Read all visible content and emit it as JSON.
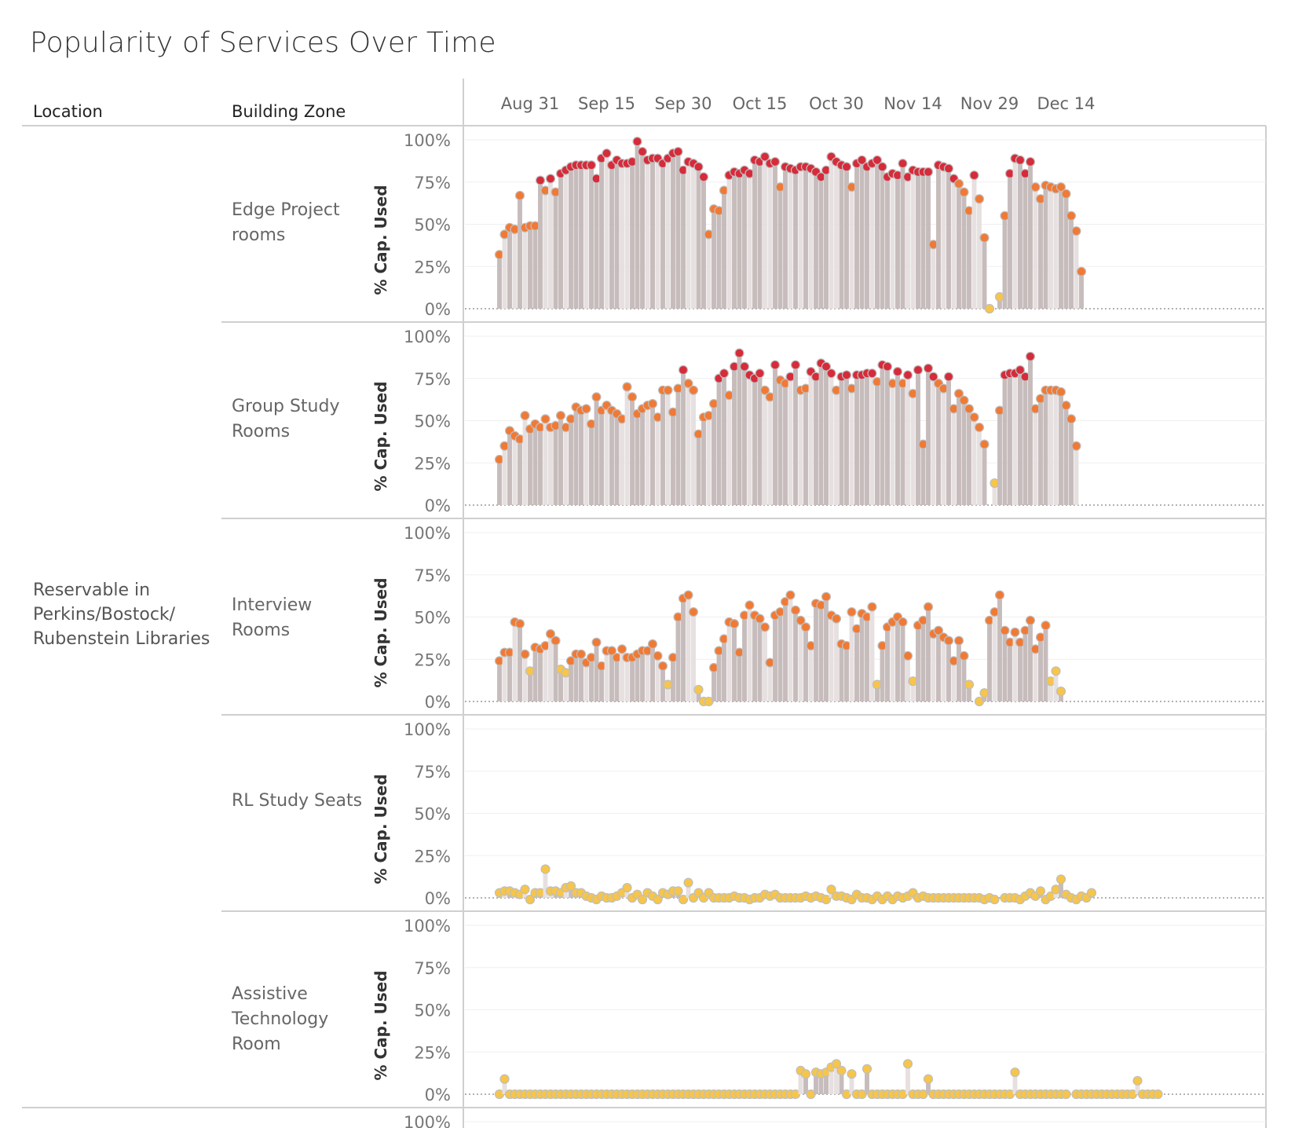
{
  "title": "Popularity of Services Over Time",
  "headers": {
    "location": "Location",
    "zone": "Building Zone"
  },
  "location": "Reservable in Perkins/Bostock/ Rubenstein Libraries",
  "colors": {
    "bar": "#c7bcbc",
    "bar_light": "#e7e0e0",
    "dot_high": "#d62b3a",
    "dot_mid": "#f07a35",
    "dot_low": "#f6c54a"
  },
  "chart_data": {
    "type": "bar",
    "x_ticks": [
      "Aug 31",
      "Sep 15",
      "Sep 30",
      "Oct 15",
      "Oct 30",
      "Nov 14",
      "Nov 29",
      "Dec 14"
    ],
    "x_start": "Aug 25",
    "ylabel": "% Cap. Used",
    "y_ticks": [
      "0%",
      "25%",
      "50%",
      "75%",
      "100%"
    ],
    "ylim": [
      0,
      100
    ],
    "series": [
      {
        "name": "Edge Project rooms",
        "values": [
          32,
          44,
          48,
          47,
          67,
          48,
          49,
          49,
          76,
          70,
          77,
          69,
          80,
          82,
          84,
          85,
          85,
          85,
          85,
          77,
          89,
          92,
          85,
          88,
          86,
          86,
          87,
          99,
          93,
          88,
          89,
          89,
          86,
          89,
          92,
          93,
          82,
          87,
          86,
          84,
          78,
          44,
          59,
          58,
          70,
          79,
          81,
          80,
          82,
          80,
          88,
          87,
          90,
          86,
          87,
          72,
          84,
          83,
          82,
          84,
          84,
          83,
          81,
          78,
          82,
          90,
          87,
          85,
          84,
          72,
          86,
          88,
          84,
          86,
          88,
          84,
          78,
          80,
          79,
          86,
          78,
          82,
          81,
          81,
          81,
          38,
          85,
          84,
          83,
          77,
          74,
          69,
          58,
          79,
          65,
          42,
          0,
          null,
          7,
          55,
          80,
          89,
          88,
          80,
          87,
          72,
          65,
          73,
          72,
          71,
          72,
          68,
          55,
          46,
          22
        ]
      },
      {
        "name": "Group Study Rooms",
        "values": [
          27,
          35,
          44,
          41,
          39,
          53,
          45,
          48,
          46,
          51,
          46,
          47,
          53,
          46,
          51,
          58,
          56,
          57,
          48,
          64,
          56,
          59,
          56,
          54,
          51,
          70,
          64,
          54,
          57,
          59,
          60,
          52,
          68,
          68,
          55,
          69,
          80,
          72,
          68,
          42,
          52,
          53,
          60,
          75,
          78,
          65,
          82,
          90,
          82,
          77,
          75,
          78,
          68,
          64,
          83,
          74,
          72,
          76,
          83,
          68,
          69,
          79,
          76,
          84,
          82,
          78,
          68,
          76,
          77,
          69,
          77,
          77,
          78,
          78,
          73,
          83,
          82,
          72,
          79,
          72,
          77,
          66,
          80,
          36,
          81,
          76,
          72,
          69,
          76,
          57,
          66,
          62,
          57,
          52,
          46,
          36,
          null,
          13,
          56,
          77,
          78,
          78,
          80,
          76,
          88,
          57,
          63,
          68,
          68,
          68,
          67,
          59,
          51,
          35
        ]
      },
      {
        "name": "Interview Rooms",
        "values": [
          24,
          29,
          29,
          47,
          46,
          28,
          18,
          32,
          31,
          33,
          40,
          36,
          19,
          17,
          24,
          28,
          28,
          23,
          26,
          35,
          21,
          30,
          30,
          26,
          31,
          26,
          26,
          28,
          30,
          30,
          34,
          27,
          21,
          10,
          26,
          50,
          61,
          63,
          53,
          7,
          0,
          0,
          20,
          30,
          37,
          47,
          46,
          29,
          51,
          57,
          51,
          49,
          44,
          23,
          51,
          53,
          59,
          63,
          54,
          48,
          44,
          33,
          58,
          57,
          62,
          51,
          49,
          34,
          33,
          53,
          43,
          52,
          50,
          56,
          10,
          33,
          44,
          47,
          50,
          47,
          27,
          12,
          45,
          48,
          56,
          40,
          42,
          38,
          36,
          24,
          36,
          27,
          10,
          null,
          0,
          5,
          48,
          53,
          63,
          42,
          35,
          41,
          35,
          42,
          48,
          31,
          38,
          45,
          12,
          18,
          6
        ]
      },
      {
        "name": "RL Study Seats",
        "values": [
          3,
          4,
          4,
          3,
          2,
          5,
          -1,
          3,
          3,
          17,
          4,
          4,
          3,
          6,
          7,
          3,
          3,
          1,
          0,
          -1,
          1,
          0,
          0,
          1,
          3,
          6,
          0,
          2,
          -1,
          3,
          1,
          -1,
          3,
          2,
          4,
          4,
          -1,
          9,
          0,
          3,
          0,
          3,
          0,
          0,
          0,
          0,
          1,
          0,
          0,
          -1,
          0,
          0,
          2,
          1,
          2,
          0,
          0,
          0,
          0,
          0,
          1,
          0,
          1,
          0,
          -1,
          5,
          1,
          1,
          0,
          -1,
          2,
          0,
          0,
          -1,
          1,
          -1,
          1,
          -1,
          1,
          0,
          1,
          3,
          0,
          1,
          0,
          0,
          0,
          0,
          0,
          0,
          0,
          0,
          0,
          0,
          0,
          -1,
          0,
          -1,
          null,
          0,
          0,
          0,
          -1,
          1,
          3,
          1,
          4,
          -1,
          1,
          5,
          11,
          2,
          0,
          -1,
          1,
          0,
          3
        ]
      },
      {
        "name": "Assistive Technology Room",
        "values": [
          0,
          9,
          0,
          0,
          0,
          0,
          0,
          0,
          0,
          0,
          0,
          0,
          0,
          0,
          0,
          0,
          0,
          0,
          0,
          0,
          0,
          0,
          0,
          0,
          0,
          0,
          0,
          0,
          0,
          0,
          0,
          0,
          0,
          0,
          0,
          0,
          0,
          0,
          0,
          0,
          0,
          0,
          0,
          0,
          0,
          0,
          0,
          0,
          0,
          0,
          0,
          0,
          0,
          0,
          0,
          0,
          0,
          0,
          0,
          14,
          12,
          0,
          13,
          12,
          13,
          16,
          18,
          14,
          0,
          12,
          0,
          0,
          15,
          0,
          0,
          0,
          0,
          0,
          0,
          0,
          18,
          0,
          0,
          0,
          9,
          0,
          0,
          0,
          0,
          0,
          0,
          0,
          0,
          0,
          0,
          0,
          0,
          0,
          0,
          0,
          0,
          13,
          0,
          0,
          0,
          0,
          0,
          0,
          0,
          0,
          0,
          0,
          null,
          0,
          0,
          0,
          0,
          0,
          0,
          0,
          0,
          0,
          0,
          0,
          0,
          8,
          0,
          0,
          0,
          0
        ]
      }
    ],
    "grid": true
  }
}
